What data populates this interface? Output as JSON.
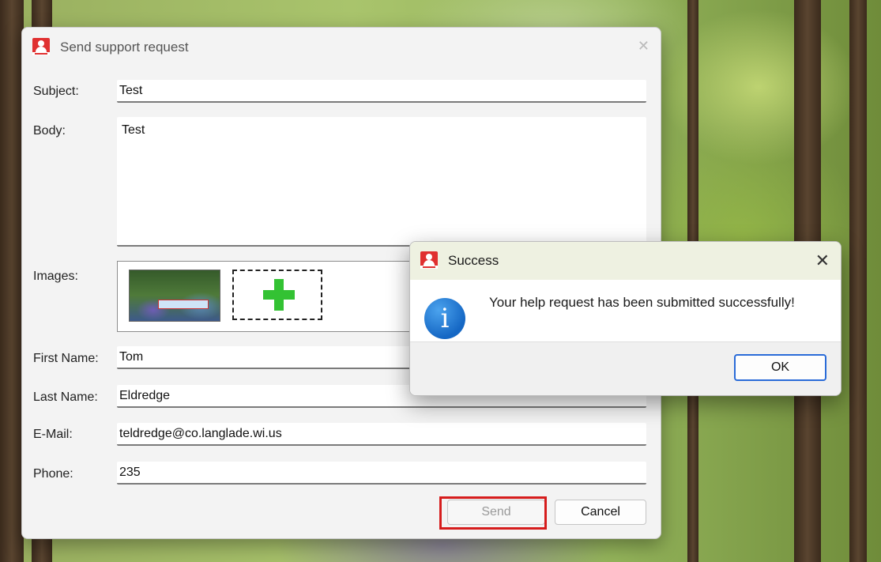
{
  "support_dialog": {
    "title": "Send support request",
    "fields": {
      "subject": {
        "label": "Subject:",
        "value": "Test"
      },
      "body": {
        "label": "Body:",
        "value": "Test"
      },
      "images": {
        "label": "Images:"
      },
      "first_name": {
        "label": "First Name:",
        "value": "Tom"
      },
      "last_name": {
        "label": "Last Name:",
        "value": "Eldredge"
      },
      "email": {
        "label": "E-Mail:",
        "value": "teldredge@co.langlade.wi.us"
      },
      "phone": {
        "label": "Phone:",
        "value": "235"
      }
    },
    "buttons": {
      "send": "Send",
      "cancel": "Cancel"
    }
  },
  "success_dialog": {
    "title": "Success",
    "message": "Your help request has been submitted successfully!",
    "ok_label": "OK",
    "icon": "info-icon",
    "close_icon": "close-icon"
  },
  "colors": {
    "highlight": "#d61d1d",
    "accent": "#2a6bd8",
    "app_icon": "#e03030",
    "add_plus": "#33c233"
  }
}
